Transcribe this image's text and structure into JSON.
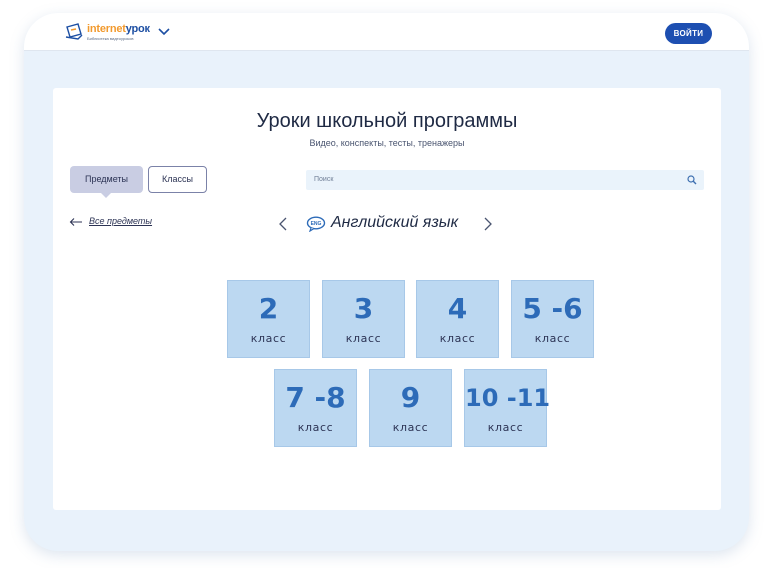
{
  "header": {
    "logo_part1": "internet",
    "logo_part2": "урок",
    "logo_subtitle": "Библиотека видеоуроков",
    "login_label": "ВОЙТИ",
    "brand_orange": "#f29a2e",
    "brand_blue": "#1d4fa3"
  },
  "main": {
    "title": "Уроки школьной программы",
    "subtitle": "Видео, конспекты, тесты, тренажеры",
    "tabs": [
      {
        "label": "Предметы",
        "active": true
      },
      {
        "label": "Классы",
        "active": false
      }
    ],
    "search": {
      "placeholder": "Поиск",
      "icon": "search-icon"
    },
    "back_link": "Все предметы",
    "subject": {
      "name": "Английский язык",
      "badge": "ENG"
    },
    "grades": [
      {
        "number": "2",
        "label": "класс"
      },
      {
        "number": "3",
        "label": "класс"
      },
      {
        "number": "4",
        "label": "класс"
      },
      {
        "number": "5 -6",
        "label": "класс"
      },
      {
        "number": "7 -8",
        "label": "класс"
      },
      {
        "number": "9",
        "label": "класс"
      },
      {
        "number": "10 -11",
        "label": "класс"
      }
    ]
  },
  "colors": {
    "tile_bg": "#bcd8f1",
    "tile_number": "#2d6bb8",
    "primary_button": "#1d4fb1"
  }
}
